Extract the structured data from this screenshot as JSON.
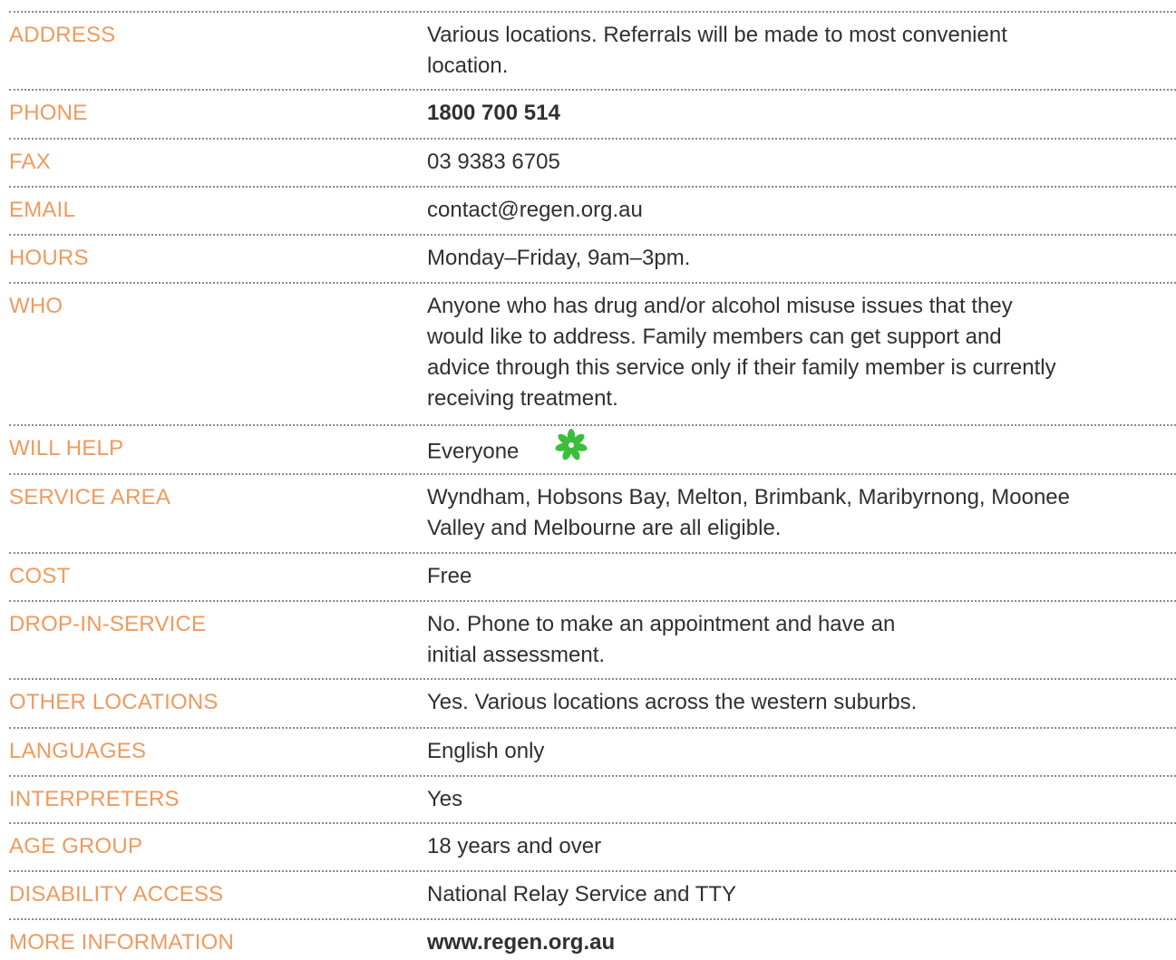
{
  "rows": [
    {
      "label": "ADDRESS",
      "lines": [
        "Various locations. Referrals will be made to most convenient",
        "location."
      ]
    },
    {
      "label": "PHONE",
      "value": "1800 700 514"
    },
    {
      "label": "FAX",
      "value": "03 9383 6705"
    },
    {
      "label": "EMAIL",
      "value": "contact@regen.org.au"
    },
    {
      "label": "HOURS",
      "value": "Monday–Friday, 9am–3pm."
    },
    {
      "label": "WHO",
      "lines": [
        "Anyone who has drug and/or alcohol misuse issues that they",
        "would like to address. Family members can get support and",
        "advice through this service only if their family member is currently",
        "receiving treatment."
      ]
    },
    {
      "label": "WILL HELP",
      "value": "Everyone",
      "icon": "green-flower-icon"
    },
    {
      "label": "SERVICE AREA",
      "lines": [
        "Wyndham, Hobsons Bay, Melton, Brimbank, Maribyrnong, Moonee",
        "Valley and Melbourne are all eligible."
      ]
    },
    {
      "label": "COST",
      "value": "Free"
    },
    {
      "label": "DROP-IN-SERVICE",
      "lines": [
        "No. Phone to make an appointment and have an",
        "initial assessment."
      ]
    },
    {
      "label": "OTHER LOCATIONS",
      "value": "Yes. Various locations across the western suburbs."
    },
    {
      "label": "LANGUAGES",
      "value": "English only"
    },
    {
      "label": "INTERPRETERS",
      "value": "Yes"
    },
    {
      "label": "AGE GROUP",
      "value": "18 years and over"
    },
    {
      "label": "DISABILITY ACCESS",
      "value": "National Relay Service and TTY"
    },
    {
      "label": "MORE INFORMATION",
      "value": "www.regen.org.au"
    }
  ],
  "colors": {
    "label": "#ef9a5e",
    "value": "#303030",
    "divider": "#8a8a8a",
    "flower": "#3bbf3b"
  }
}
